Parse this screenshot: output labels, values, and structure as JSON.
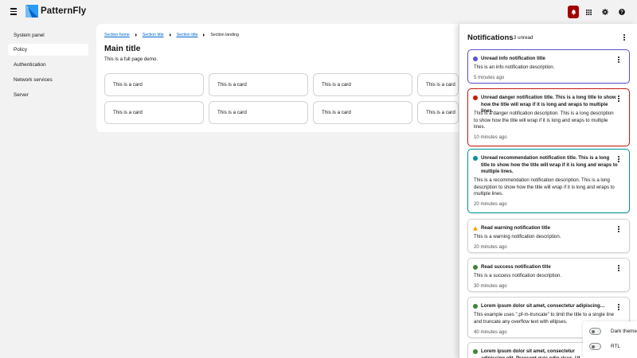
{
  "masthead": {
    "brand": "PatternFly",
    "icons": [
      "bars-icon",
      "patternfly-logo-icon",
      "bell-icon",
      "grid-icon",
      "gear-icon",
      "help-icon"
    ]
  },
  "sidebar": {
    "items": [
      {
        "label": "System panel",
        "active": false
      },
      {
        "label": "Policy",
        "active": true
      },
      {
        "label": "Authentication",
        "active": false
      },
      {
        "label": "Network services",
        "active": false
      },
      {
        "label": "Server",
        "active": false
      }
    ]
  },
  "main": {
    "breadcrumb": [
      "Section home",
      "Section title",
      "Section title",
      "Section landing"
    ],
    "title": "Main title",
    "description": "This is a full page demo.",
    "cards": [
      "This is a card",
      "This is a card",
      "This is a card",
      "This is a card",
      "This is a card",
      "This is a card",
      "This is a card",
      "This is a card"
    ]
  },
  "drawer": {
    "title": "Notifications",
    "unread": "3 unread",
    "notifications": [
      {
        "variant": "info",
        "title": "Unread info notification title",
        "description": "This is an info notification description.",
        "time": "5 minutes ago"
      },
      {
        "variant": "danger",
        "title": "Unread danger notification title. This is a long title to show how the title will wrap if it is long and wraps to multiple lines.",
        "description": "This is a danger notification description. This is a long description to show how the title will wrap if it is long and wraps to multiple lines.",
        "time": "10 minutes ago"
      },
      {
        "variant": "recommendation",
        "title": "Unread recommendation notification title. This is a long title to show how the title will wrap if it is long and wraps to multiple lines.",
        "description": "This is a recommendation notification description. This is a long description to show how the title will wrap if it is long and wraps to multiple lines.",
        "time": "20 minutes ago"
      },
      {
        "variant": "warning",
        "title": "Read warning notification title",
        "description": "This is a warning notification description.",
        "time": "20 minutes ago"
      },
      {
        "variant": "success",
        "title": "Read success notification title",
        "description": "This is a success notification description.",
        "time": "30 minutes ago"
      },
      {
        "variant": "success",
        "title": "Lorem ipsum dolor sit amet, consectetur adipiscing elit.",
        "description": "This example uses \".pf-m-truncate\" to limit the title to a single line and truncate any overflow text with ellipses.",
        "time": "40 minutes ago"
      },
      {
        "variant": "success",
        "title": "Lorem ipsum dolor sit amet, consectetur adipiscing elit. Praesent quis odio risus. Ut dictum vitae sapien at posuere.",
        "description": "",
        "time": ""
      }
    ]
  },
  "theme": {
    "dark_theme": "Dark theme",
    "rtl": "RTL"
  },
  "colors": {
    "info": "#5752d1",
    "danger": "#c9190b",
    "recommendation": "#009596",
    "warning": "#f0ab00",
    "success": "#3e8635",
    "bell_active": "#a30000",
    "link": "#0066cc"
  }
}
